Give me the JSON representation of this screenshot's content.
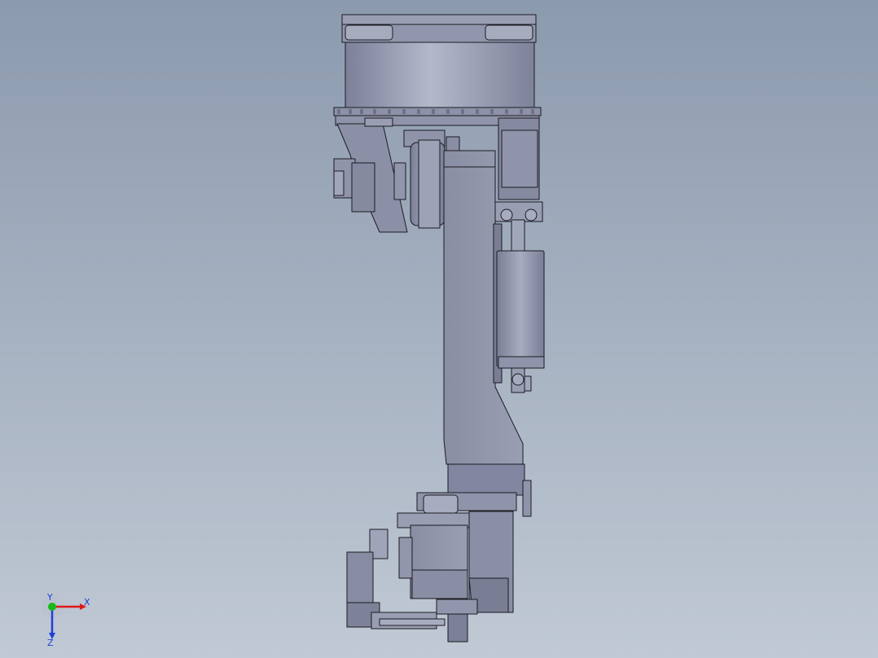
{
  "viewport": {
    "background_top": "#8c9aae",
    "background_bottom": "#c0c9d4",
    "model_fill": "#8e92a8",
    "model_light": "#a9adc0",
    "model_dark": "#6e7288",
    "edge_color": "#1b1b22"
  },
  "triad": {
    "x_label": "X",
    "y_label": "Y",
    "z_label": "Z",
    "x_color": "#e01818",
    "y_color": "#18b818",
    "z_color": "#1e3fd8"
  }
}
